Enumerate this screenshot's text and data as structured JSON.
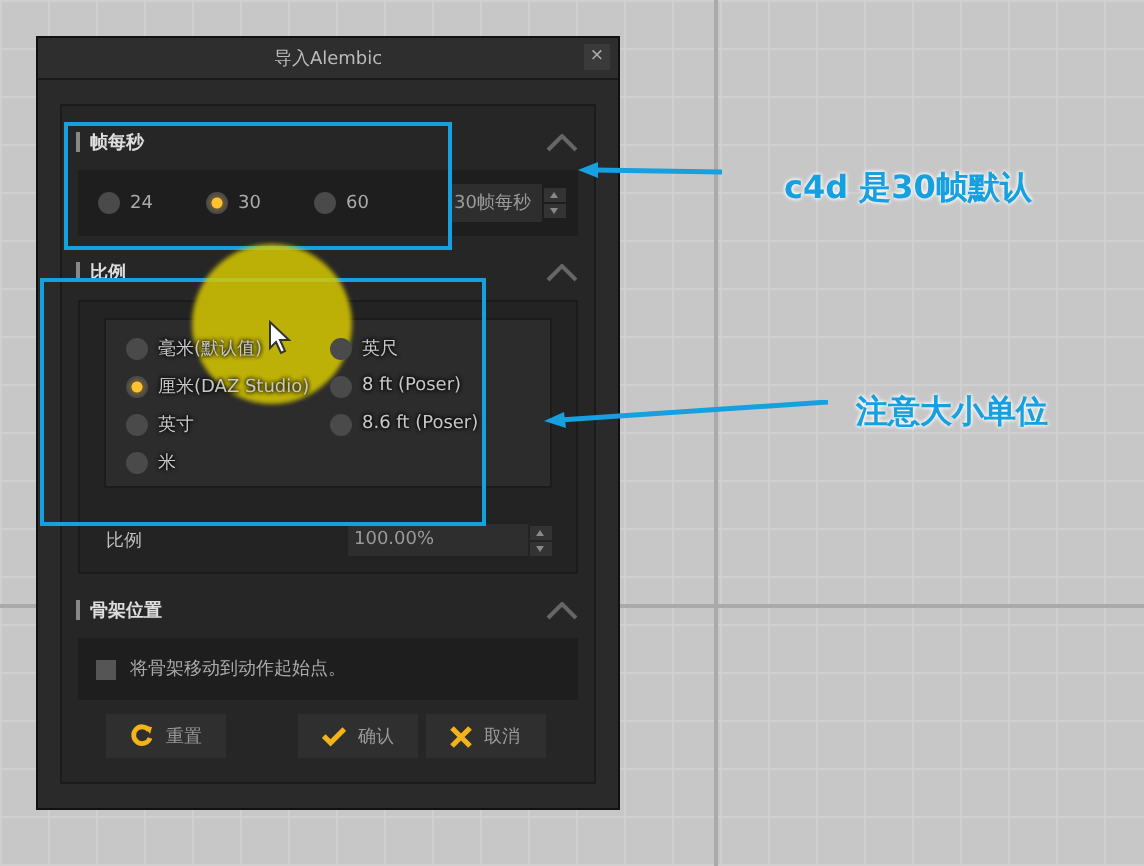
{
  "dialog": {
    "title": "导入Alembic",
    "close": "×"
  },
  "frame_rate": {
    "title": "帧每秒",
    "expanded": true,
    "options": [
      {
        "label": "24",
        "selected": false
      },
      {
        "label": "30",
        "selected": true
      },
      {
        "label": "60",
        "selected": false
      }
    ],
    "field": {
      "value": "30帧每秒",
      "disabled": true
    }
  },
  "scale": {
    "title": "比例",
    "expanded": true,
    "units": [
      {
        "label": "毫米(默认值)",
        "selected": false
      },
      {
        "label": "厘米(DAZ Studio)",
        "selected": true
      },
      {
        "label": "英寸",
        "selected": false
      },
      {
        "label": "米",
        "selected": false
      },
      {
        "label": "英尺",
        "selected": false
      },
      {
        "label": "8 ft (Poser)",
        "selected": false
      },
      {
        "label": "8.6 ft (Poser)",
        "selected": false
      }
    ],
    "ratio_label": "比例",
    "ratio_field": {
      "value": "100.00%",
      "disabled": true
    }
  },
  "skeleton": {
    "title": "骨架位置",
    "expanded": true,
    "checkbox": {
      "label": "将骨架移动到动作起始点。",
      "checked": false
    }
  },
  "buttons": [
    {
      "kind": "reset",
      "label": "重置"
    },
    {
      "kind": "confirm",
      "label": "确认"
    },
    {
      "kind": "cancel",
      "label": "取消"
    }
  ],
  "annotations": [
    {
      "text": "c4d 是30帧默认"
    },
    {
      "text": "注意大小单位"
    }
  ]
}
